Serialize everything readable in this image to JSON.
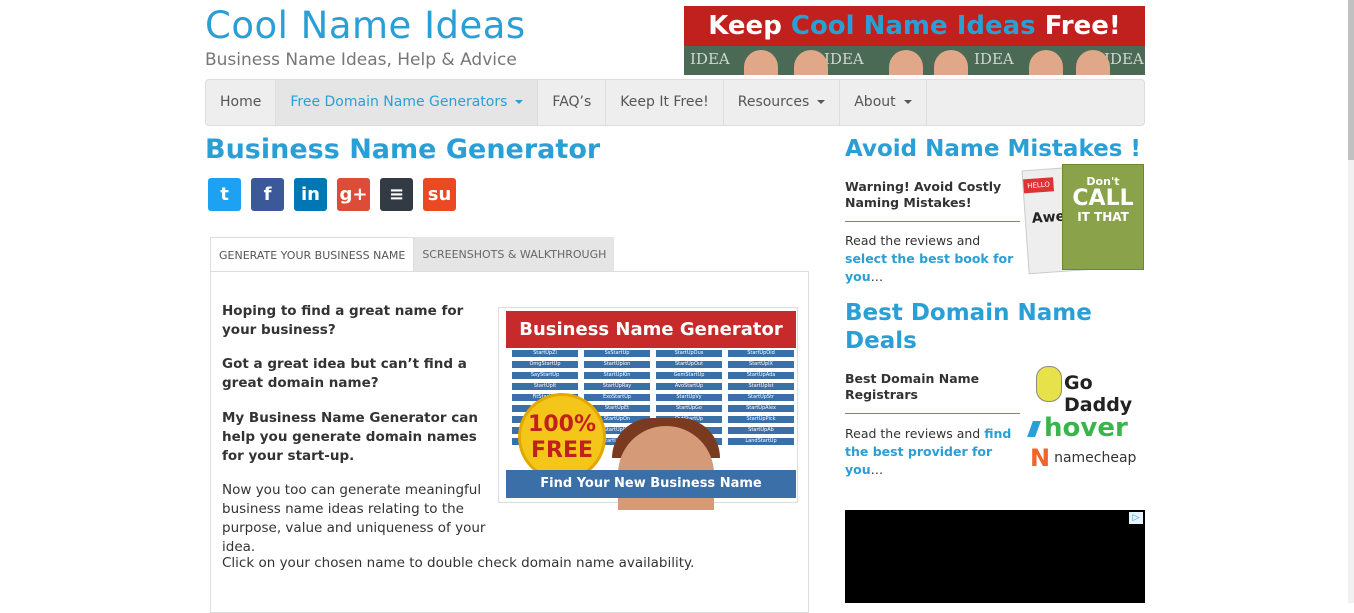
{
  "header": {
    "site_title": "Cool Name Ideas",
    "tagline": "Business Name Ideas, Help & Advice",
    "banner": {
      "prefix": "Keep ",
      "highlight": "Cool Name Ideas",
      "suffix": " Free!",
      "background_text": "IDEA"
    }
  },
  "nav": {
    "items": [
      {
        "label": "Home"
      },
      {
        "label": "Free Domain Name Generators"
      },
      {
        "label": "FAQ’s"
      },
      {
        "label": "Keep It Free!"
      },
      {
        "label": "Resources"
      },
      {
        "label": "About"
      }
    ]
  },
  "main": {
    "title": "Business Name Generator",
    "social": [
      {
        "name": "twitter-icon",
        "glyph": "t",
        "color": "#1da1f2"
      },
      {
        "name": "facebook-icon",
        "glyph": "f",
        "color": "#3b5998"
      },
      {
        "name": "linkedin-icon",
        "glyph": "in",
        "color": "#0077b5"
      },
      {
        "name": "googleplus-icon",
        "glyph": "g+",
        "color": "#dd4b39"
      },
      {
        "name": "buffer-icon",
        "glyph": "≡",
        "color": "#323b43"
      },
      {
        "name": "stumbleupon-icon",
        "glyph": "su",
        "color": "#eb4924"
      }
    ],
    "tabs": [
      {
        "label": "GENERATE YOUR BUSINESS NAME"
      },
      {
        "label": "SCREENSHOTS & WALKTHROUGH"
      }
    ],
    "bold_paras": [
      "Hoping to find a great name for your business?",
      "Got a great idea but can’t find a great domain name?",
      "My Business Name Generator can help you generate domain names for your start-up."
    ],
    "para1": "Now you too can generate meaningful business name ideas relating to the purpose, value and uniqueness of your idea.",
    "para2": "Click on your chosen name to double check domain name availability.",
    "promo": {
      "title": "Business Name Generator",
      "badge_top": "100%",
      "badge_bottom": "FREE",
      "footer": "Find Your New Business Name",
      "grid_names": [
        "StartUpZi",
        "SsStartUp",
        "StartUpOus",
        "StartUpOid",
        "OmgStartUp",
        "StartUpion",
        "StartUpOut",
        "StartUpIX",
        "SayStartUp",
        "StartUpKin",
        "GemStartUp",
        "StartUpAda",
        "StartUpIt",
        "StartUpRay",
        "AvoStartUp",
        "StartUpIst",
        "FitStartUp",
        "ExoStartUp",
        "StartUpVy",
        "StartUpStr",
        "StartUpDuo",
        "StartUpEt",
        "StartUpGo",
        "StartUpAlex",
        "StartUpIon",
        "StartUpOn",
        "OutStartUp",
        "StartUpPick",
        "StartUpIty",
        "StartUpIfic",
        "StartUpIst",
        "StartUpAb",
        "StartUpTrue",
        "StartUpLant",
        "StartUpEx",
        "LandStartUp"
      ]
    }
  },
  "sidebar": {
    "section1": {
      "heading": "Avoid Name Mistakes !",
      "bold": "Warning! Avoid Costly Naming Mistakes!",
      "text_pre": "Read the reviews and ",
      "link": "select the best book for you",
      "text_post": "…",
      "book1_title": "Awes",
      "book1_ribbon": "HELLO",
      "book2_line1": "Don't",
      "book2_line2": "CALL",
      "book2_line3": "IT THAT"
    },
    "section2": {
      "heading": "Best Domain Name Deals",
      "bold": "Best Domain Name Registrars",
      "text_pre": "Read the reviews and ",
      "link": "find the best provider for you",
      "text_post": "…",
      "logos": {
        "godaddy": "Go Daddy",
        "hover": "hover",
        "namecheap": "namecheap"
      }
    },
    "ad": {
      "icon": "▷"
    }
  },
  "colors": {
    "accent": "#2a9fd6",
    "banner_red": "#c0211f",
    "promo_blue": "#3b6fa8"
  }
}
